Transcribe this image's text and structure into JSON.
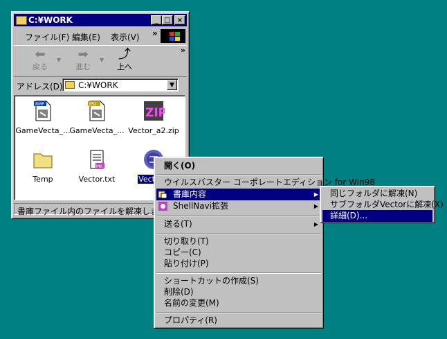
{
  "window": {
    "title": "C:¥WORK",
    "buttons": {
      "minimize": "_",
      "maximize": "□",
      "close": "×"
    },
    "menu": [
      "ファイル(F)",
      "編集(E)",
      "表示(V)"
    ],
    "menu_more": "»",
    "toolbar": {
      "back": "戻る",
      "forward": "進む",
      "up": "上へ",
      "more": "»"
    },
    "address": {
      "label": "アドレス(D)",
      "value": "C:¥WORK"
    },
    "status": "書庫ファイル内のファイルを解凍します。"
  },
  "files": [
    {
      "name": "GameVecta_...",
      "badge": "BMP"
    },
    {
      "name": "GameVecta_...",
      "badge": "JPG"
    },
    {
      "name": "Vector_a2.zip",
      "badge": "ZIP"
    },
    {
      "name": "Temp"
    },
    {
      "name": "Vector.txt",
      "badge": "MK"
    },
    {
      "name": "Vector.L"
    }
  ],
  "context_menu": {
    "open": "開く(O)",
    "virusbuster": "ウイルスバスター コーポレートエディション for Win98",
    "archive": "書庫内容",
    "shellnavi": "ShellNavi拡張",
    "send_to": "送る(T)",
    "cut": "切り取り(T)",
    "copy": "コピー(C)",
    "paste": "貼り付け(P)",
    "shortcut": "ショートカットの作成(S)",
    "delete": "削除(D)",
    "rename": "名前の変更(M)",
    "properties": "プロパティ(R)"
  },
  "submenu": {
    "extract_same": "同じフォルダに解凍(N)",
    "extract_sub": "サブフォルダVectorに解凍(X)",
    "details": "詳細(D)..."
  }
}
